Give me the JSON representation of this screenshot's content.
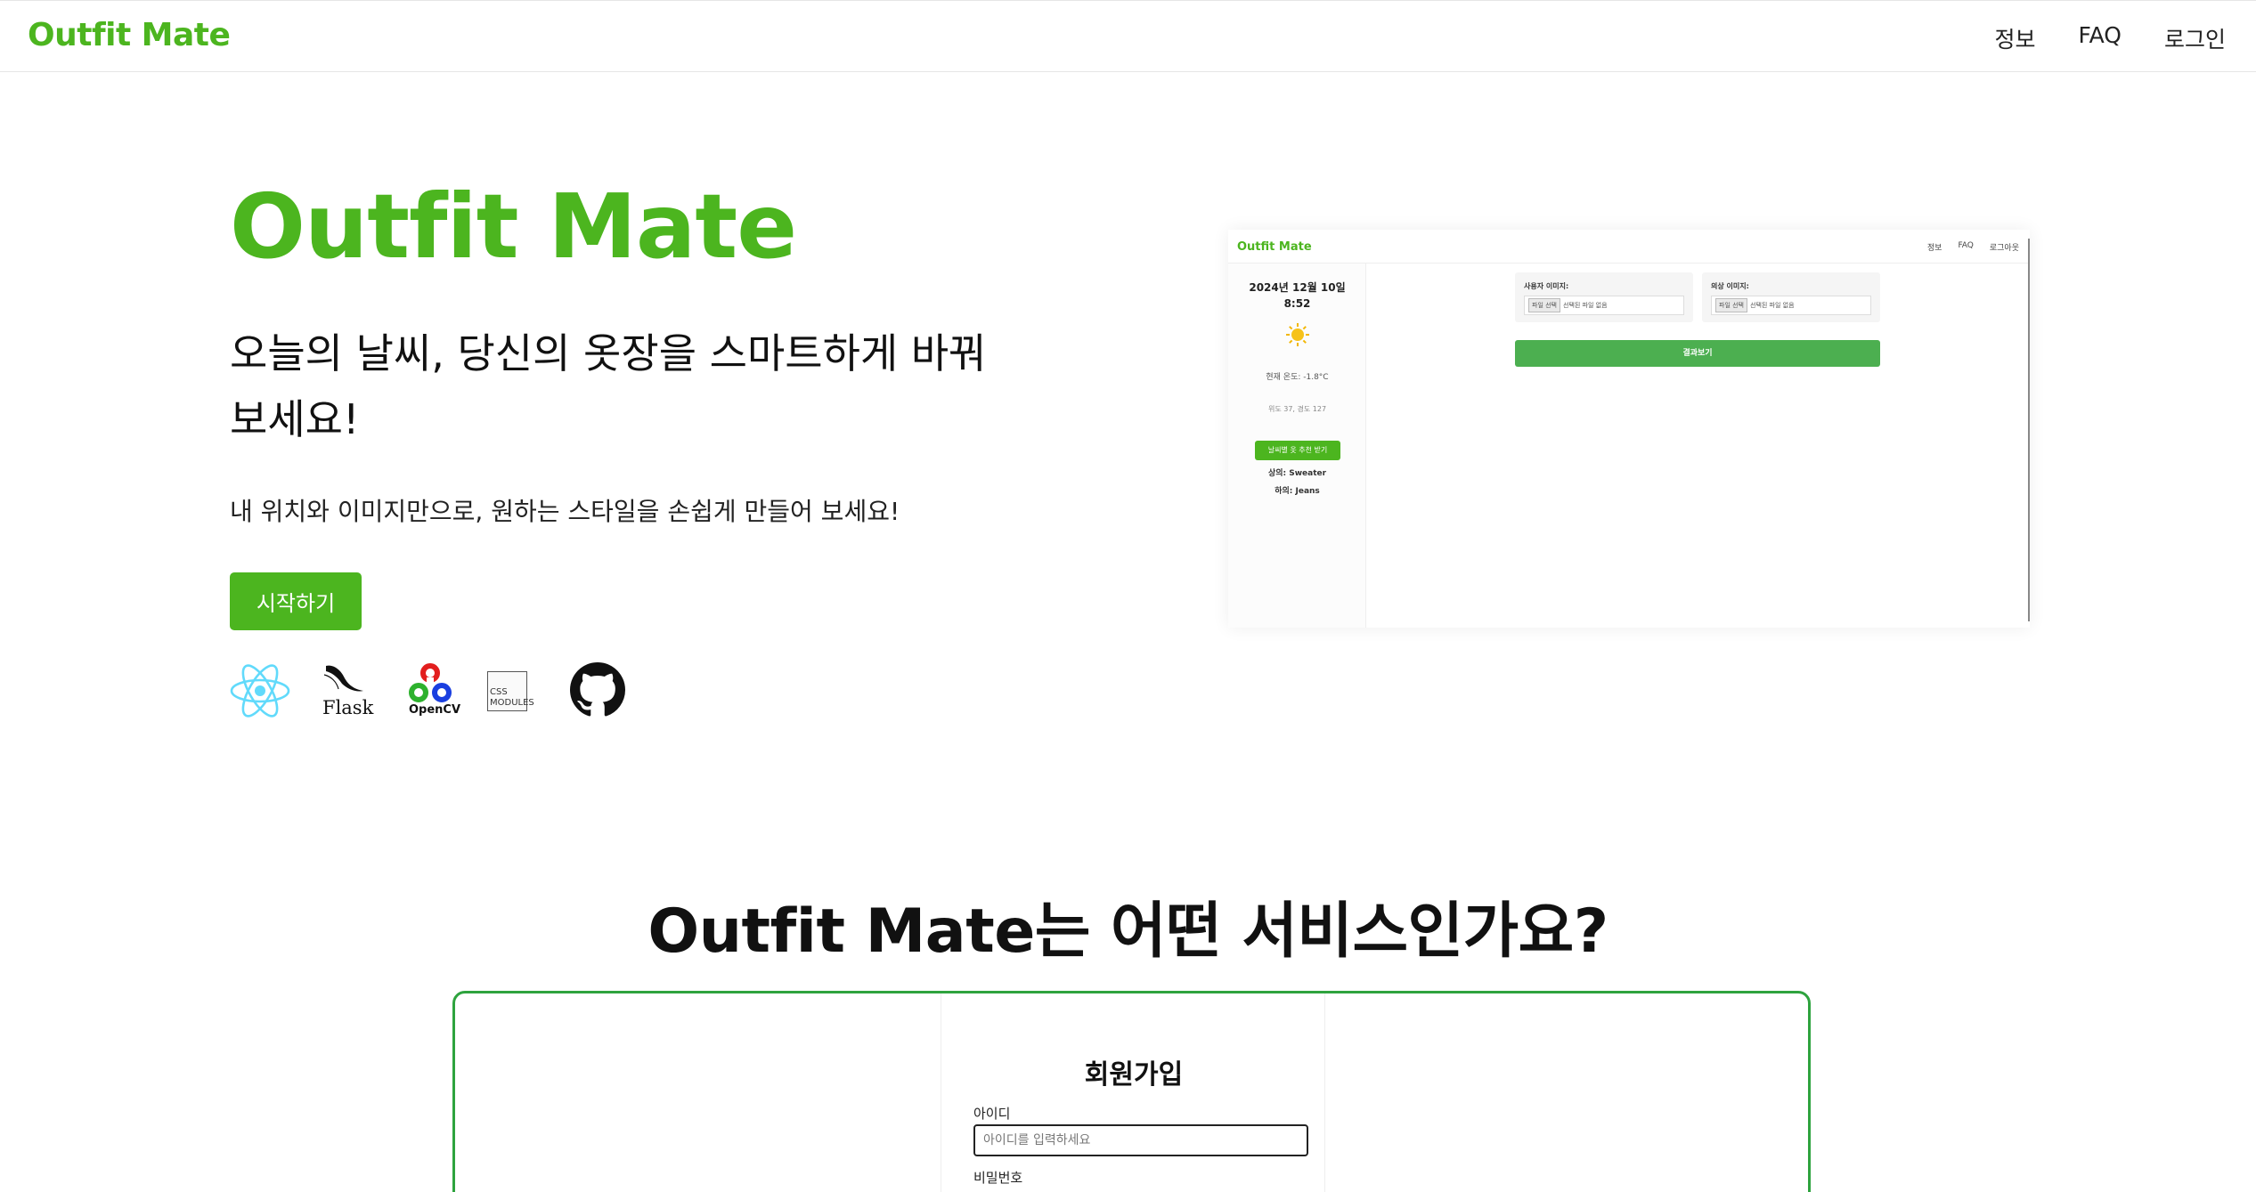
{
  "nav": {
    "brand": "Outfit Mate",
    "links": [
      "정보",
      "FAQ",
      "로그인"
    ]
  },
  "hero": {
    "title": "Outfit Mate",
    "subtitle": "오늘의 날씨, 당신의 옷장을 스마트하게 바꿔보세요!",
    "description": "내 위치와 이미지만으로, 원하는 스타일을 손쉽게 만들어 보세요!",
    "cta": "시작하기"
  },
  "tech_stack": {
    "icons": [
      "react-icon",
      "flask-icon",
      "opencv-icon",
      "css-modules-icon",
      "github-icon"
    ],
    "flask_label": "Flask",
    "opencv_label": "OpenCV",
    "css_label_1": "CSS",
    "css_label_2": "MODULES"
  },
  "preview": {
    "brand": "Outfit Mate",
    "links": [
      "정보",
      "FAQ",
      "로그아웃"
    ],
    "date": "2024년 12월 10일",
    "time": "8:52",
    "temperature": "현재 온도: -1.8°C",
    "coords": "위도 37, 경도 127",
    "recommend_button": "날씨별 옷 추천 받기",
    "top": "상의: Sweater",
    "bottom": "하의: Jeans",
    "upload1_label": "사용자 이미지:",
    "upload2_label": "의상 이미지:",
    "file_button": "파일 선택",
    "no_file": "선택된 파일 없음",
    "result_button": "결과보기"
  },
  "section": {
    "title": "Outfit Mate는 어떤 서비스인가요?"
  },
  "signup": {
    "title": "회원가입",
    "id_label": "아이디",
    "id_placeholder": "아이디를 입력하세요",
    "pw_label": "비밀번호"
  },
  "colors": {
    "brand_green": "#4cb51f",
    "frame_green": "#2ea33e",
    "react_blue": "#61dafb"
  }
}
